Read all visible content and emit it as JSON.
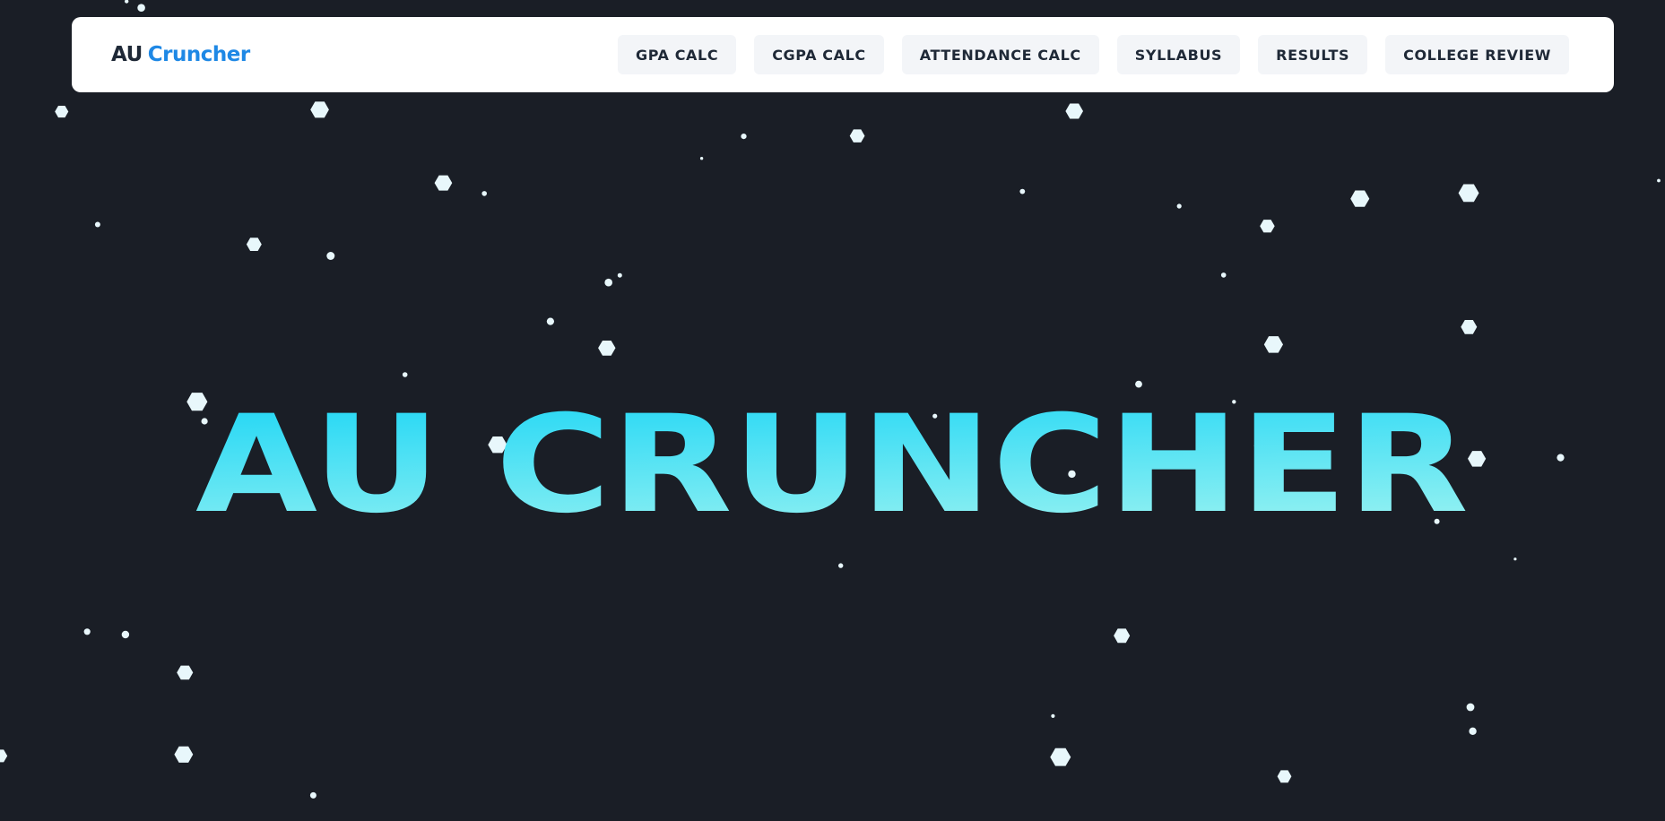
{
  "navbar": {
    "brand_prefix": "AU",
    "brand_suffix": "Cruncher",
    "links": [
      {
        "label": "GPA CALC"
      },
      {
        "label": "CGPA CALC"
      },
      {
        "label": "ATTENDANCE CALC"
      },
      {
        "label": "SYLLABUS"
      },
      {
        "label": "RESULTS"
      },
      {
        "label": "COLLEGE REVIEW"
      }
    ]
  },
  "hero": {
    "title": "AU CRUNCHER"
  },
  "colors": {
    "background": "#1a1e26",
    "accent": "#1e88e5",
    "hero_gradient_start": "#17d4f5",
    "hero_gradient_end": "#8ff0f2",
    "particle": "#e8f7fb"
  },
  "particles": {
    "count": 60
  }
}
